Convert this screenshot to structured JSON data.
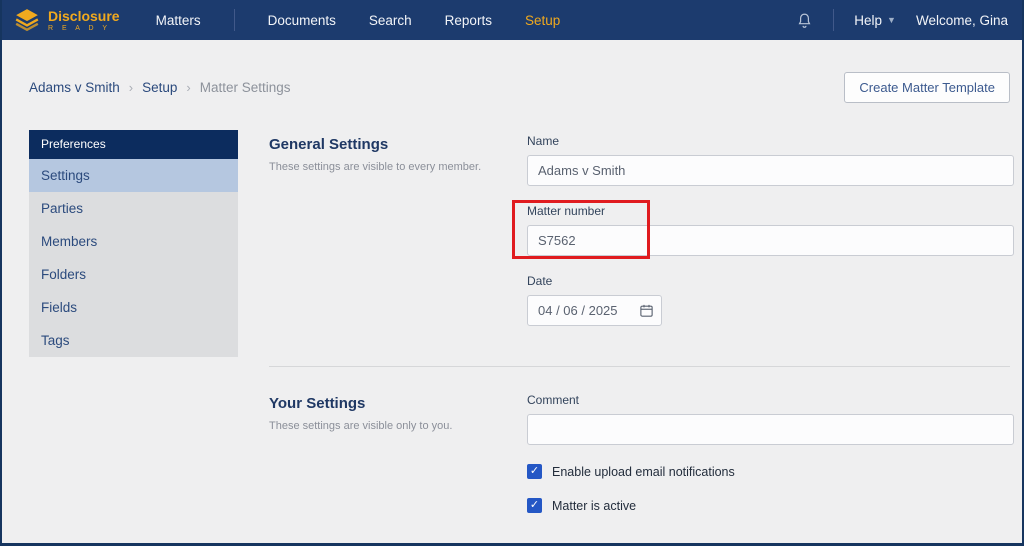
{
  "nav": {
    "brand": {
      "name": "Disclosure",
      "sub": "R E A D Y"
    },
    "items": [
      {
        "label": "Matters",
        "active": false
      },
      {
        "label": "Documents",
        "active": false
      },
      {
        "label": "Search",
        "active": false
      },
      {
        "label": "Reports",
        "active": false
      },
      {
        "label": "Setup",
        "active": true
      }
    ],
    "help_label": "Help",
    "welcome_label": "Welcome, Gina"
  },
  "breadcrumb": {
    "items": [
      "Adams v Smith",
      "Setup",
      "Matter Settings"
    ],
    "separator": "›"
  },
  "actions": {
    "create_matter_template": "Create Matter Template"
  },
  "sidebar": {
    "header": "Preferences",
    "items": [
      {
        "label": "Settings",
        "active": true
      },
      {
        "label": "Parties",
        "active": false
      },
      {
        "label": "Members",
        "active": false
      },
      {
        "label": "Folders",
        "active": false
      },
      {
        "label": "Fields",
        "active": false
      },
      {
        "label": "Tags",
        "active": false
      }
    ]
  },
  "general_settings": {
    "title": "General Settings",
    "subtitle": "These settings are visible to every member.",
    "name_label": "Name",
    "name_value": "Adams v Smith",
    "matter_number_label": "Matter number",
    "matter_number_value": "S7562",
    "date_label": "Date",
    "date_value": "04 / 06 / 2025"
  },
  "your_settings": {
    "title": "Your Settings",
    "subtitle": "These settings are visible only to you.",
    "comment_label": "Comment",
    "comment_value": "",
    "checkboxes": [
      {
        "label": "Enable upload email notifications",
        "checked": true,
        "check_glyph": "✓"
      },
      {
        "label": "Matter is active",
        "checked": true,
        "check_glyph": "✓"
      }
    ]
  },
  "annotation": {
    "type": "highlight-box",
    "target": "matter-number-field",
    "color": "#e01b1f"
  },
  "colors": {
    "nav_background": "#1c3b6e",
    "brand_gold": "#f0a91e",
    "sidebar_header": "#0c2c5e",
    "sidebar_selected": "#b5c7e0",
    "checkbox_blue": "#2457c5",
    "page_background": "#efeff0"
  }
}
